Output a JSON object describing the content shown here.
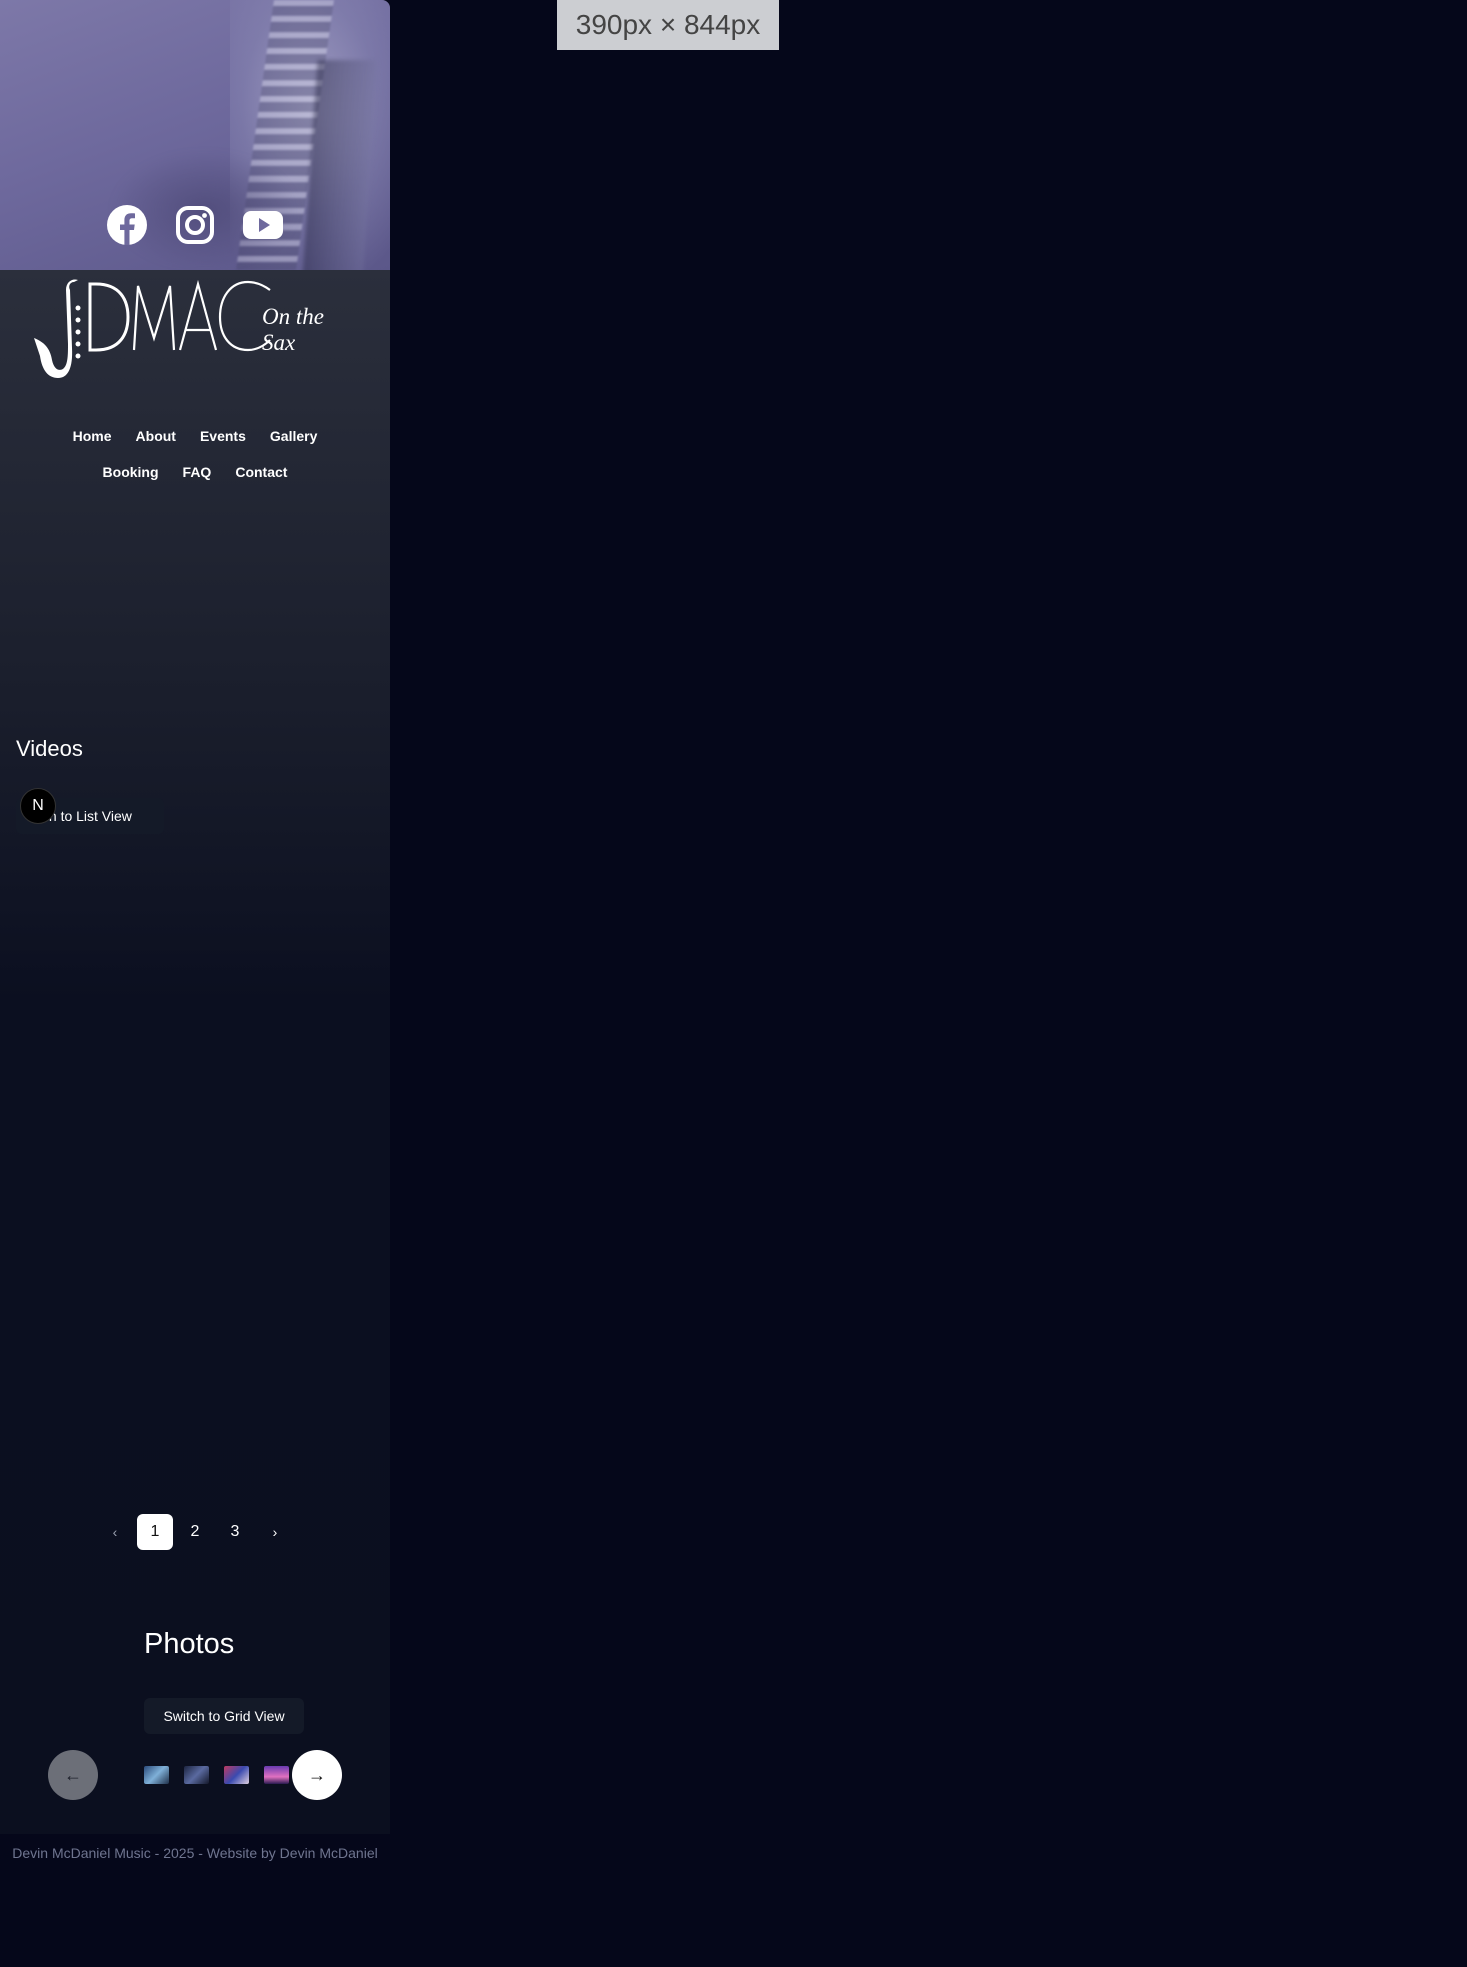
{
  "size_badge": "390px × 844px",
  "social": {
    "icons": [
      "facebook-icon",
      "instagram-icon",
      "youtube-icon"
    ]
  },
  "logo": {
    "wordmark": "DMAC",
    "tagline": "On the Sax"
  },
  "nav": {
    "items": [
      "Home",
      "About",
      "Events",
      "Gallery",
      "Booking",
      "FAQ",
      "Contact"
    ]
  },
  "videos": {
    "title": "Videos",
    "switch_label": "tch to List View",
    "badge": "N"
  },
  "pagination": {
    "prev_icon": "chevron-left-icon",
    "pages": [
      "1",
      "2",
      "3"
    ],
    "active_page": "1",
    "next_icon": "chevron-right-icon"
  },
  "photos": {
    "title": "Photos",
    "switch_label": "Switch to Grid View",
    "prev_icon": "arrow-left-icon",
    "next_icon": "arrow-right-icon"
  },
  "footer": {
    "text": "Devin McDaniel Music - 2025 - Website by Devin McDaniel"
  },
  "colors": {
    "page_bg": "#05071a",
    "hero_tint": "#6e699d",
    "button_bg": "#141a28",
    "footer_text": "#6f7590"
  }
}
